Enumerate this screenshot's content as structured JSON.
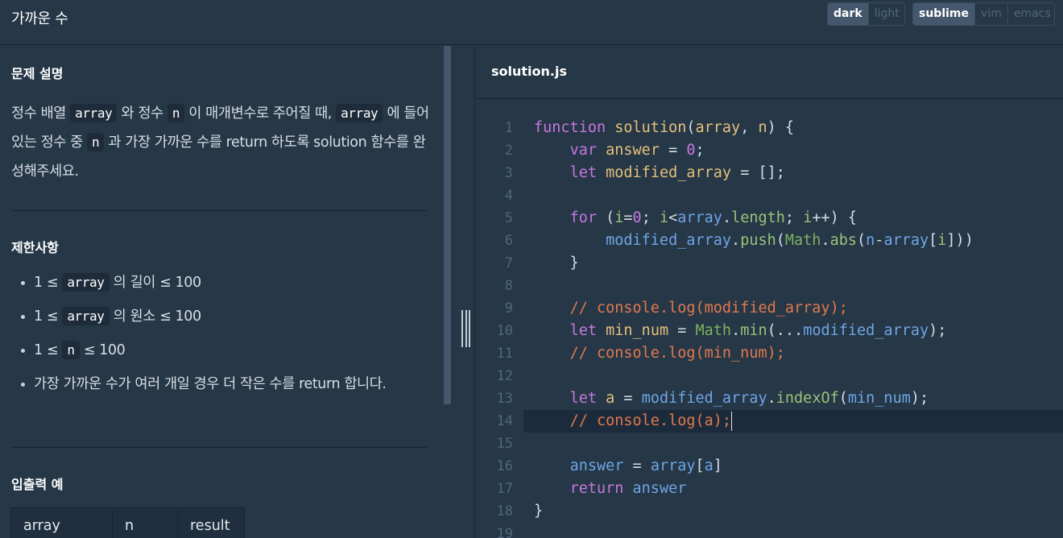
{
  "header": {
    "title": "가까운 수",
    "theme_options": [
      "dark",
      "light"
    ],
    "theme_active": "dark",
    "editor_options": [
      "sublime",
      "vim",
      "emacs"
    ],
    "editor_active": "sublime"
  },
  "problem": {
    "description_title": "문제 설명",
    "description": [
      {
        "t": "text",
        "v": "정수 배열 "
      },
      {
        "t": "code",
        "v": "array"
      },
      {
        "t": "text",
        "v": " 와 정수 "
      },
      {
        "t": "code",
        "v": "n"
      },
      {
        "t": "text",
        "v": " 이 매개변수로 주어질 때, "
      },
      {
        "t": "code",
        "v": "array"
      },
      {
        "t": "text",
        "v": " 에 들어있는 정수 중 "
      },
      {
        "t": "code",
        "v": "n"
      },
      {
        "t": "text",
        "v": " 과 가장 가까운 수를 return 하도록 solution 함수를 완성해주세요."
      }
    ],
    "limits_title": "제한사항",
    "limits": [
      {
        "pre": "1 ≤ ",
        "code": "array",
        "post": " 의 길이 ≤ 100"
      },
      {
        "pre": "1 ≤ ",
        "code": "array",
        "post": " 의 원소 ≤ 100"
      },
      {
        "pre": "1 ≤ ",
        "code": "n",
        "post": " ≤ 100"
      },
      {
        "pre": "가장 가까운 수가 여러 개일 경우 더 작은 수를 return 합니다.",
        "code": "",
        "post": ""
      }
    ],
    "io_title": "입출력 예",
    "io_headers": [
      "array",
      "n",
      "result"
    ]
  },
  "editor": {
    "filename": "solution.js",
    "active_line": 14,
    "lines": [
      [
        [
          "k",
          "function"
        ],
        [
          "p",
          " "
        ],
        [
          "f",
          "solution"
        ],
        [
          "p",
          "("
        ],
        [
          "a",
          "array"
        ],
        [
          "p",
          ", "
        ],
        [
          "a",
          "n"
        ],
        [
          "p",
          ") {"
        ]
      ],
      [
        [
          "p",
          "    "
        ],
        [
          "k",
          "var"
        ],
        [
          "p",
          " "
        ],
        [
          "f",
          "answer"
        ],
        [
          "p",
          " = "
        ],
        [
          "n",
          "0"
        ],
        [
          "p",
          ";"
        ]
      ],
      [
        [
          "p",
          "    "
        ],
        [
          "k",
          "let"
        ],
        [
          "p",
          " "
        ],
        [
          "f",
          "modified_array"
        ],
        [
          "p",
          " = [];"
        ]
      ],
      [],
      [
        [
          "p",
          "    "
        ],
        [
          "k",
          "for"
        ],
        [
          "p",
          " ("
        ],
        [
          "g",
          "i"
        ],
        [
          "p",
          "="
        ],
        [
          "n",
          "0"
        ],
        [
          "p",
          "; "
        ],
        [
          "g",
          "i"
        ],
        [
          "p",
          "<"
        ],
        [
          "v",
          "array"
        ],
        [
          "p",
          "."
        ],
        [
          "g",
          "length"
        ],
        [
          "p",
          "; "
        ],
        [
          "g",
          "i"
        ],
        [
          "p",
          "++) {"
        ]
      ],
      [
        [
          "p",
          "        "
        ],
        [
          "v",
          "modified_array"
        ],
        [
          "p",
          "."
        ],
        [
          "g",
          "push"
        ],
        [
          "p",
          "("
        ],
        [
          "m",
          "Math"
        ],
        [
          "p",
          "."
        ],
        [
          "g",
          "abs"
        ],
        [
          "p",
          "("
        ],
        [
          "v",
          "n"
        ],
        [
          "p",
          "-"
        ],
        [
          "v",
          "array"
        ],
        [
          "p",
          "["
        ],
        [
          "g",
          "i"
        ],
        [
          "p",
          "]))"
        ]
      ],
      [
        [
          "p",
          "    }"
        ]
      ],
      [],
      [
        [
          "p",
          "    "
        ],
        [
          "c",
          "// console.log(modified_array);"
        ]
      ],
      [
        [
          "p",
          "    "
        ],
        [
          "k",
          "let"
        ],
        [
          "p",
          " "
        ],
        [
          "f",
          "min_num"
        ],
        [
          "p",
          " = "
        ],
        [
          "m",
          "Math"
        ],
        [
          "p",
          "."
        ],
        [
          "g",
          "min"
        ],
        [
          "p",
          "(..."
        ],
        [
          "v",
          "modified_array"
        ],
        [
          "p",
          ");"
        ]
      ],
      [
        [
          "p",
          "    "
        ],
        [
          "c",
          "// console.log(min_num);"
        ]
      ],
      [],
      [
        [
          "p",
          "    "
        ],
        [
          "k",
          "let"
        ],
        [
          "p",
          " "
        ],
        [
          "f",
          "a"
        ],
        [
          "p",
          " = "
        ],
        [
          "v",
          "modified_array"
        ],
        [
          "p",
          "."
        ],
        [
          "g",
          "indexOf"
        ],
        [
          "p",
          "("
        ],
        [
          "v",
          "min_num"
        ],
        [
          "p",
          ");"
        ]
      ],
      [
        [
          "p",
          "    "
        ],
        [
          "c",
          "// console.log(a);"
        ]
      ],
      [],
      [
        [
          "p",
          "    "
        ],
        [
          "v",
          "answer"
        ],
        [
          "p",
          " = "
        ],
        [
          "v",
          "array"
        ],
        [
          "p",
          "["
        ],
        [
          "v",
          "a"
        ],
        [
          "p",
          "]"
        ]
      ],
      [
        [
          "p",
          "    "
        ],
        [
          "k",
          "return"
        ],
        [
          "p",
          " "
        ],
        [
          "v",
          "answer"
        ]
      ],
      [
        [
          "p",
          "}"
        ]
      ],
      []
    ]
  }
}
